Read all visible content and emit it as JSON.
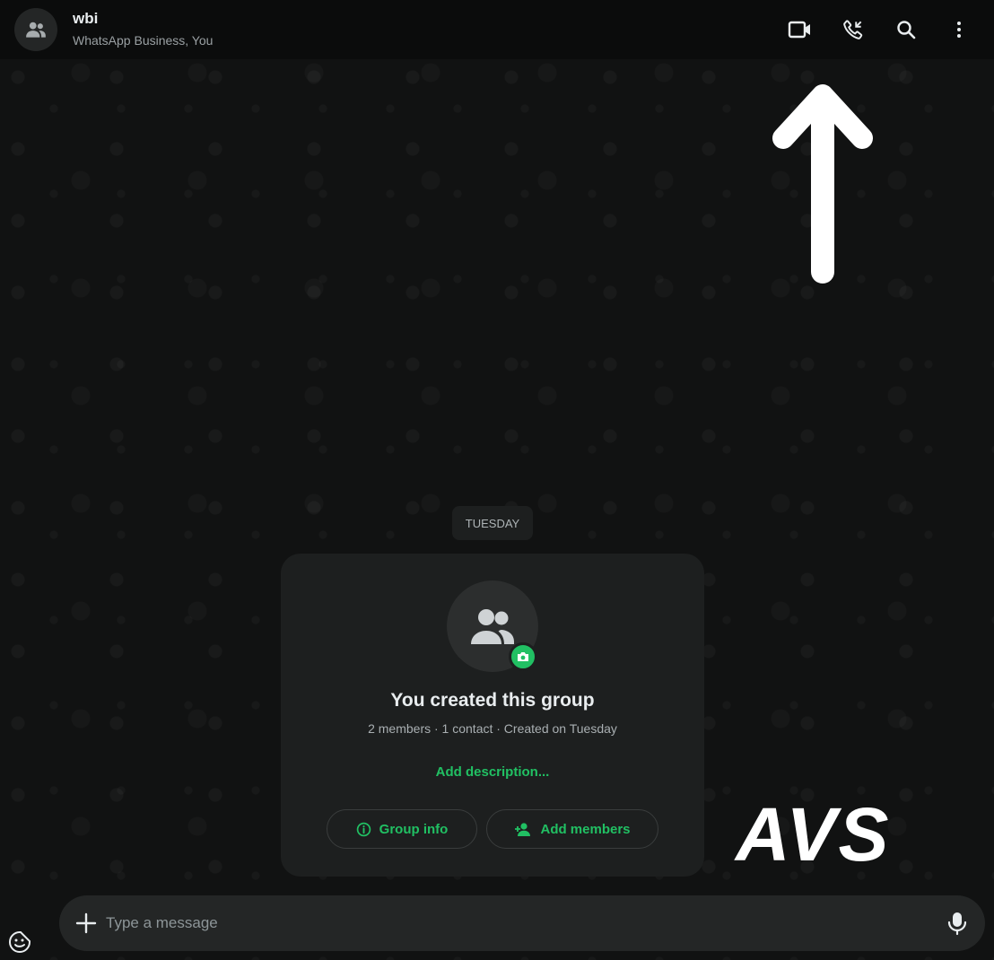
{
  "header": {
    "chat_name": "wbi",
    "chat_subtitle": "WhatsApp Business, You",
    "avatar_icon": "group-icon",
    "actions": [
      {
        "name": "video-call-button",
        "icon": "video-camera-icon"
      },
      {
        "name": "voice-call-button",
        "icon": "phone-icon"
      },
      {
        "name": "search-button",
        "icon": "search-icon"
      },
      {
        "name": "menu-button",
        "icon": "kebab-menu-icon"
      }
    ]
  },
  "chat": {
    "date_separator": "TUESDAY",
    "group_card": {
      "title": "You created this group",
      "meta": "2 members · 1 contact · Created on Tuesday",
      "add_description": "Add description...",
      "group_info_label": "Group info",
      "add_members_label": "Add members"
    }
  },
  "composer": {
    "placeholder": "Type a message"
  },
  "overlay": {
    "watermark_text": "AVS",
    "arrow_icon": "up-arrow-icon"
  },
  "colors": {
    "accent": "#21c063",
    "background": "#0b0c0c",
    "card": "#1d1f1f",
    "input": "#242626"
  }
}
